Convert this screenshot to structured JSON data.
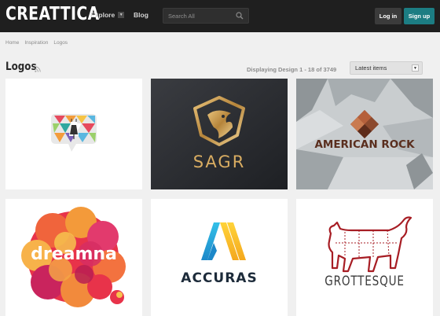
{
  "header": {
    "brand": "CREATTICA",
    "nav": {
      "explore": "Explore",
      "blog": "Blog"
    },
    "search": {
      "placeholder": "Search All"
    },
    "login": "Log in",
    "signup": "Sign up",
    "accent_color": "#1c7d83"
  },
  "breadcrumb": [
    "Home",
    "Inspiration",
    "Logos"
  ],
  "page": {
    "title": "Logos",
    "displaying": "Displaying Design 1 - 18 of 3749",
    "sort": {
      "selected": "Latest items"
    }
  },
  "gallery": {
    "items": [
      {
        "name": "speech-bubble-mosaic",
        "text": ""
      },
      {
        "name": "sagr",
        "text": "SAGR"
      },
      {
        "name": "american-rock",
        "text": "AMERICAN ROCK"
      },
      {
        "name": "dreamna",
        "text": "dreamna"
      },
      {
        "name": "accuras",
        "text": "ACCURAS"
      },
      {
        "name": "grottesque",
        "text": "GROTTESQUE"
      }
    ]
  }
}
